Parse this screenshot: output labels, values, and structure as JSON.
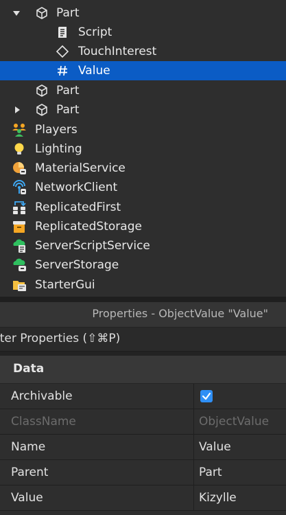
{
  "explorer": {
    "items": [
      {
        "label": "Part",
        "icon": "part-icon",
        "expanded": true
      },
      {
        "label": "Script",
        "icon": "script-icon"
      },
      {
        "label": "TouchInterest",
        "icon": "touch-interest-icon"
      },
      {
        "label": "Value",
        "icon": "object-value-icon",
        "selected": true
      },
      {
        "label": "Part",
        "icon": "part-icon"
      },
      {
        "label": "Part",
        "icon": "part-icon",
        "expanded": false
      },
      {
        "label": "Players",
        "icon": "players-icon"
      },
      {
        "label": "Lighting",
        "icon": "lighting-icon"
      },
      {
        "label": "MaterialService",
        "icon": "material-service-icon"
      },
      {
        "label": "NetworkClient",
        "icon": "network-client-icon"
      },
      {
        "label": "ReplicatedFirst",
        "icon": "replicated-first-icon"
      },
      {
        "label": "ReplicatedStorage",
        "icon": "replicated-storage-icon"
      },
      {
        "label": "ServerScriptService",
        "icon": "server-script-service-icon"
      },
      {
        "label": "ServerStorage",
        "icon": "server-storage-icon"
      },
      {
        "label": "StarterGui",
        "icon": "starter-gui-icon"
      }
    ]
  },
  "properties": {
    "title": "Properties - ObjectValue \"Value\"",
    "filter": "lter Properties (⇧⌘P)",
    "section": "Data",
    "rows": [
      {
        "key": "Archivable",
        "checked": true
      },
      {
        "key": "ClassName",
        "value": "ObjectValue",
        "disabled": true
      },
      {
        "key": "Name",
        "value": "Value"
      },
      {
        "key": "Parent",
        "value": "Part"
      },
      {
        "key": "Value",
        "value": "Kizylle"
      }
    ]
  },
  "colors": {
    "selection": "#0b5cc5",
    "checkbox": "#2f8ff5",
    "panel": "#2e2e2e"
  }
}
